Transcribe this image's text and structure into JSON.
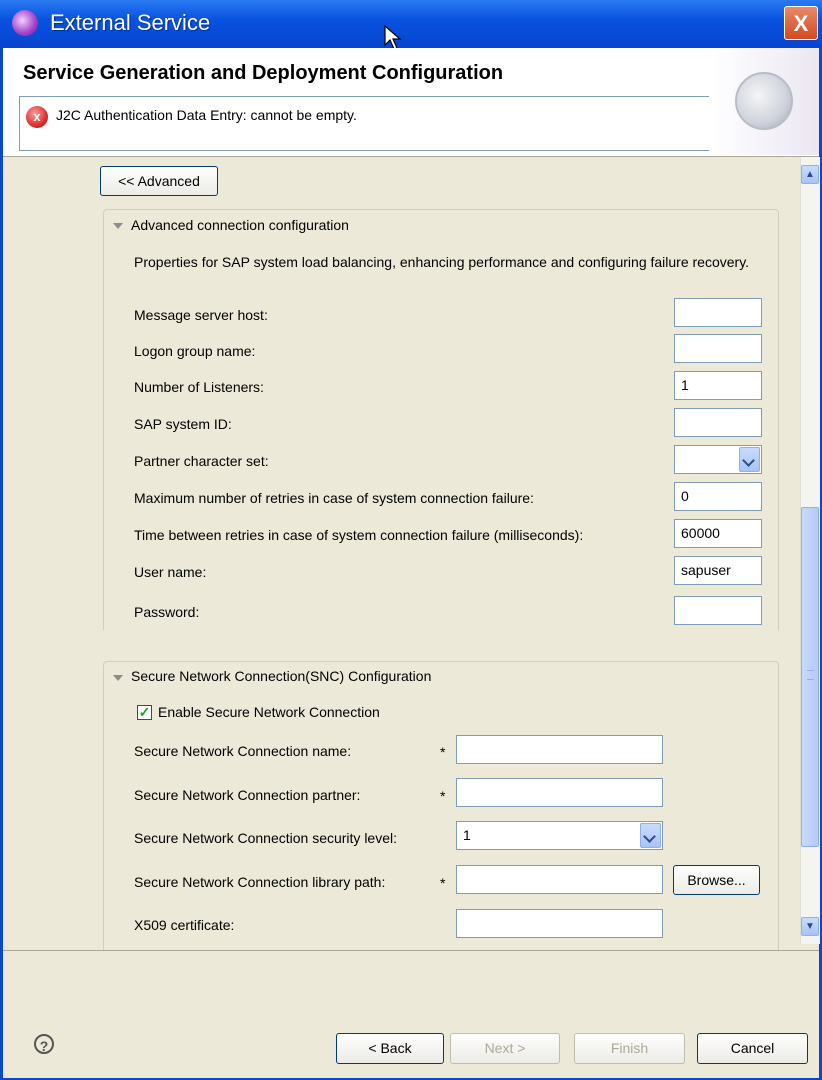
{
  "window": {
    "title": "External Service",
    "close_label": "X"
  },
  "header": {
    "title": "Service Generation and Deployment Configuration",
    "error_message": "J2C Authentication Data Entry: cannot be empty."
  },
  "advanced_button": "<< Advanced",
  "advanced_section": {
    "title": "Advanced connection configuration",
    "description": "Properties for SAP system load balancing, enhancing performance and configuring failure recovery.",
    "fields": [
      {
        "label": "Message server host:",
        "value": ""
      },
      {
        "label": "Logon group name:",
        "value": ""
      },
      {
        "label": "Number of Listeners:",
        "value": "1"
      },
      {
        "label": "SAP system ID:",
        "value": ""
      },
      {
        "label": "Partner character set:",
        "value": ""
      },
      {
        "label": "Maximum number of retries in case of system connection failure:",
        "value": "0"
      },
      {
        "label": "Time between retries in case of system connection failure (milliseconds):",
        "value": "60000"
      },
      {
        "label": "User name:",
        "value": "sapuser"
      },
      {
        "label": "Password:",
        "value": ""
      }
    ]
  },
  "snc_section": {
    "title": "Secure Network Connection(SNC) Configuration",
    "enable_label": "Enable Secure Network Connection",
    "enable_checked": true,
    "fields": [
      {
        "label": "Secure Network Connection name:",
        "required": "*",
        "value": ""
      },
      {
        "label": "Secure Network Connection partner:",
        "required": "*",
        "value": ""
      },
      {
        "label": "Secure Network Connection security level:",
        "required": "",
        "value": "1"
      },
      {
        "label": "Secure Network Connection library path:",
        "required": "*",
        "value": ""
      },
      {
        "label": "X509 certificate:",
        "required": "",
        "value": ""
      }
    ],
    "browse_label": "Browse..."
  },
  "footer": {
    "help_label": "?",
    "back": "< Back",
    "next": "Next >",
    "finish": "Finish",
    "cancel": "Cancel"
  }
}
